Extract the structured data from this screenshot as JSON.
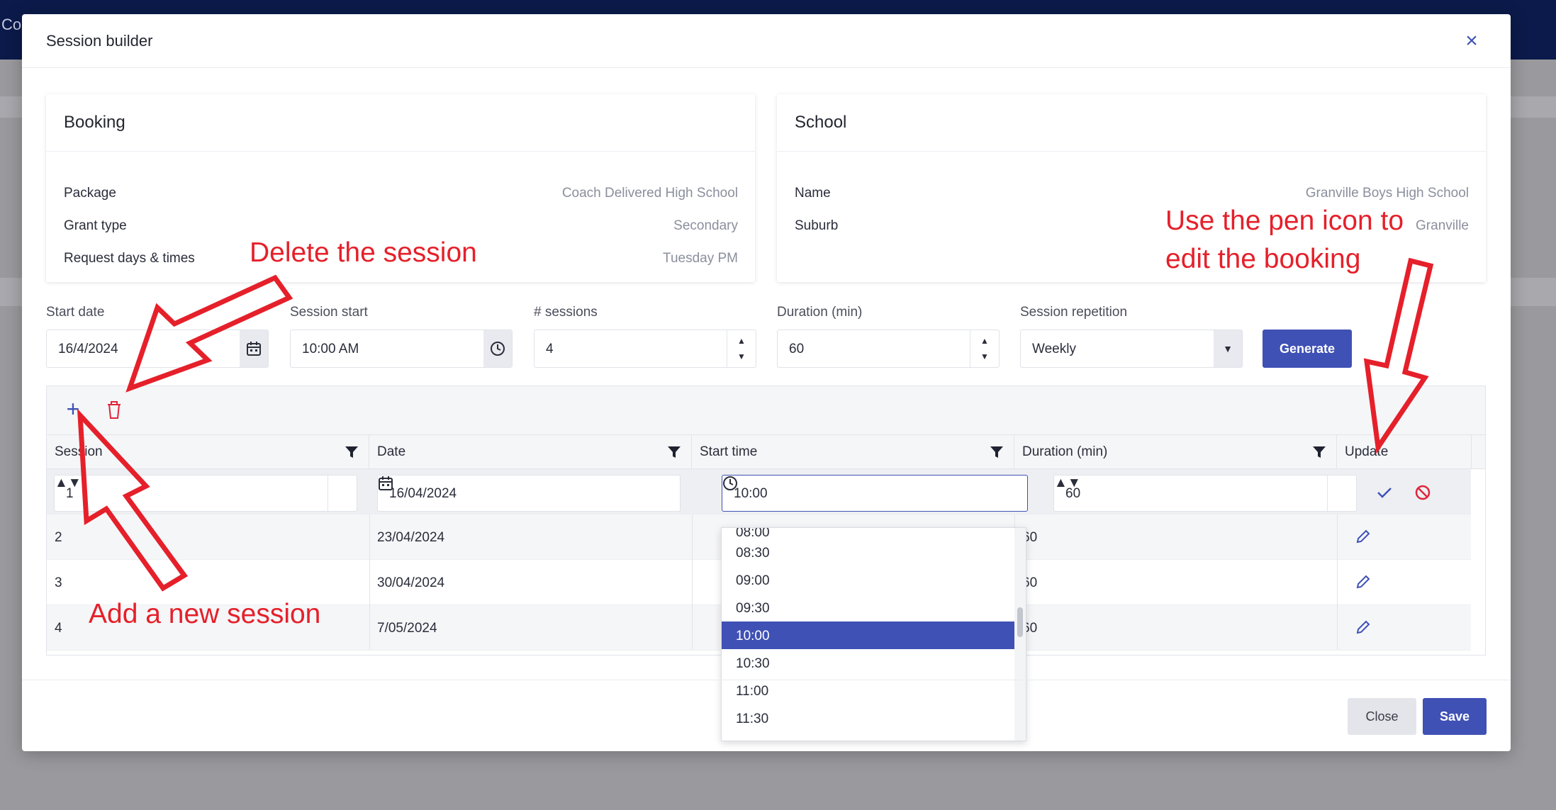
{
  "background": {
    "app_name": "Co"
  },
  "modal": {
    "title": "Session builder",
    "close_icon": "close-icon"
  },
  "booking": {
    "title": "Booking",
    "rows": [
      {
        "label": "Package",
        "value": "Coach Delivered High School"
      },
      {
        "label": "Grant type",
        "value": "Secondary"
      },
      {
        "label": "Request days & times",
        "value": "Tuesday PM"
      }
    ]
  },
  "school": {
    "title": "School",
    "rows": [
      {
        "label": "Name",
        "value": "Granville Boys High School"
      },
      {
        "label": "Suburb",
        "value": "Granville"
      }
    ]
  },
  "form": {
    "start_date": {
      "label": "Start date",
      "value": "16/4/2024"
    },
    "session_start": {
      "label": "Session start",
      "value": "10:00 AM"
    },
    "num_sessions": {
      "label": "# sessions",
      "value": "4"
    },
    "duration": {
      "label": "Duration (min)",
      "value": "60"
    },
    "repetition": {
      "label": "Session repetition",
      "value": "Weekly"
    },
    "generate_label": "Generate"
  },
  "grid": {
    "columns": [
      "Session",
      "Date",
      "Start time",
      "Duration (min)",
      "Update"
    ],
    "edit_row": {
      "session": "1",
      "date": "16/04/2024",
      "start_time": "10:00",
      "duration": "60"
    },
    "rows": [
      {
        "session": "2",
        "date": "23/04/2024",
        "duration": "60"
      },
      {
        "session": "3",
        "date": "30/04/2024",
        "duration": "60"
      },
      {
        "session": "4",
        "date": "7/05/2024",
        "duration": "60"
      }
    ]
  },
  "time_dropdown": {
    "options": [
      "08:30",
      "09:00",
      "09:30",
      "10:00",
      "10:30",
      "11:00",
      "11:30"
    ],
    "selected": "10:00"
  },
  "footer": {
    "close_label": "Close",
    "save_label": "Save"
  },
  "annotations": {
    "delete": "Delete the session",
    "add": "Add a new session",
    "pen_line1": "Use the pen icon to",
    "pen_line2": "edit the booking"
  },
  "colors": {
    "accent": "#3f51b5",
    "annotation": "#e5202a",
    "danger": "#e0243b"
  }
}
